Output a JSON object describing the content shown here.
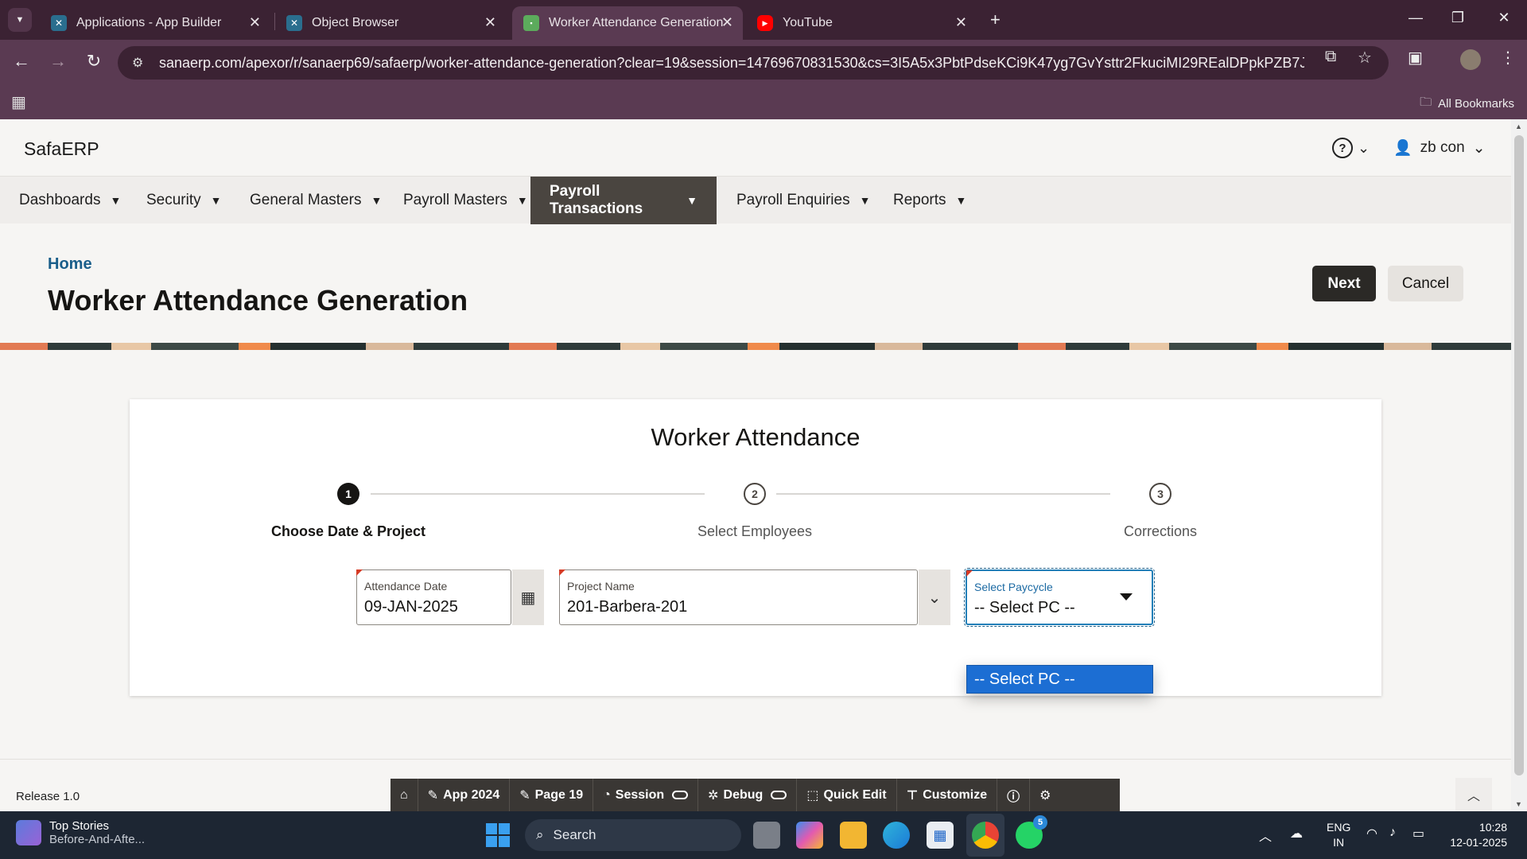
{
  "browser": {
    "tabs": [
      {
        "title": "Applications - App Builder",
        "icon": "apex-icon"
      },
      {
        "title": "Object Browser",
        "icon": "apex-icon"
      },
      {
        "title": "Worker Attendance Generation",
        "icon": "safaerp-icon"
      },
      {
        "title": "YouTube",
        "icon": "youtube-icon"
      }
    ],
    "url": "sanaerp.com/apexor/r/sanaerp69/safaerp/worker-attendance-generation?clear=19&session=14769670831530&cs=3I5A5x3PbtPdseKCi9K47yg7GvYsttr2FkuciMI29REalDPpkPZB7J4sTq5dvT...",
    "bookmarks_label": "All Bookmarks"
  },
  "app": {
    "brand": "SafaERP",
    "user": "zb con",
    "menu": [
      {
        "label": "Dashboards"
      },
      {
        "label": "Security"
      },
      {
        "label": "General Masters"
      },
      {
        "label": "Payroll Masters"
      },
      {
        "label": "Payroll Transactions"
      },
      {
        "label": "Payroll Enquiries"
      },
      {
        "label": "Reports"
      }
    ],
    "breadcrumb": "Home",
    "page_title": "Worker Attendance Generation",
    "next_label": "Next",
    "cancel_label": "Cancel"
  },
  "wizard": {
    "title": "Worker Attendance",
    "steps": [
      {
        "num": "1",
        "label": "Choose Date & Project"
      },
      {
        "num": "2",
        "label": "Select Employees"
      },
      {
        "num": "3",
        "label": "Corrections"
      }
    ],
    "current_step": 1,
    "fields": {
      "attendance_date": {
        "label": "Attendance Date",
        "value": "09-JAN-2025"
      },
      "project_name": {
        "label": "Project Name",
        "value": "201-Barbera-201"
      },
      "paycycle": {
        "label": "Select Paycycle",
        "value": "-- Select PC --"
      }
    },
    "dropdown_options": [
      "-- Select PC --"
    ]
  },
  "footer": {
    "release": "Release 1.0",
    "devbar": {
      "app": "App 2024",
      "page": "Page 19",
      "session": "Session",
      "debug": "Debug",
      "quick_edit": "Quick Edit",
      "customize": "Customize"
    }
  },
  "taskbar": {
    "news_title": "Top Stories",
    "news_sub": "Before-And-Afte...",
    "search_placeholder": "Search",
    "whatsapp_badge": "5",
    "lang_1": "ENG",
    "lang_2": "IN",
    "time": "10:28",
    "date": "12-01-2025"
  }
}
